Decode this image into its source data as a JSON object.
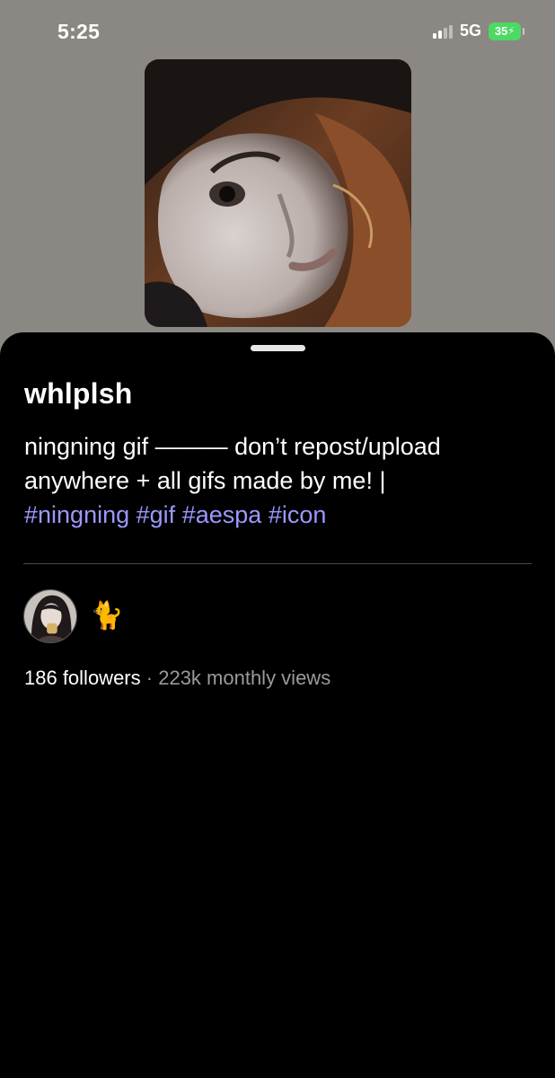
{
  "status_bar": {
    "time": "5:25",
    "network": "5G",
    "battery": "35"
  },
  "board": {
    "title": "whlplsh",
    "description_text": "ningning gif ——— don’t repost/upload anywhere + all gifs made by me! |",
    "hashtags": [
      "#ningning",
      "#gif",
      "#aespa",
      "#icon"
    ],
    "collaborator_emoji": "🐈",
    "followers": "186 followers",
    "separator": "·",
    "monthly_views": "223k monthly views"
  },
  "colors": {
    "background_top": "#8b8782",
    "sheet": "#000000",
    "hashtag": "#9b98ff",
    "battery": "#4cd964"
  },
  "icons": [
    "signal-icon",
    "battery-icon",
    "cat-emoji-icon"
  ]
}
